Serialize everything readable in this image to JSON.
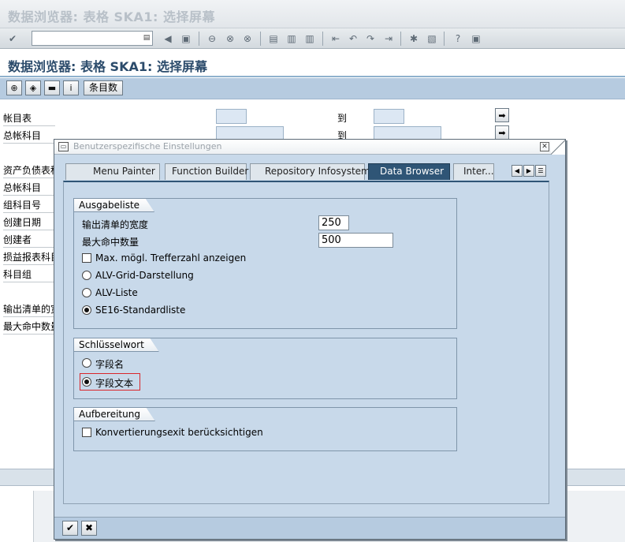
{
  "window": {
    "title": "数据浏览器: 表格 SKA1: 选择屏幕"
  },
  "toolbar": {
    "icons": [
      "enter-icon",
      "back-icon",
      "exit-icon",
      "cancel-icon",
      "print-icon",
      "find-icon",
      "find-next-icon",
      "first-page-icon",
      "prev-page-icon",
      "next-page-icon",
      "last-page-icon",
      "new-session-icon",
      "shortcut-icon",
      "help-icon",
      "layout-icon"
    ]
  },
  "app": {
    "title": "数据浏览器: 表格 SKA1: 选择屏幕",
    "number_of_entries_label": "条目数"
  },
  "selection": {
    "to_label": "到",
    "rows": [
      {
        "label": "帐目表"
      },
      {
        "label": "总帐科目"
      },
      {
        "label": "资产负债表科目"
      },
      {
        "label": "总帐科目"
      },
      {
        "label": "组科目号"
      },
      {
        "label": "创建日期"
      },
      {
        "label": "创建者"
      },
      {
        "label": "损益报表科目"
      },
      {
        "label": "科目组"
      },
      {
        "label": "输出清单的宽度"
      },
      {
        "label": "最大命中数量"
      }
    ]
  },
  "dialog": {
    "title": "Benutzerspezifische Einstellungen",
    "tabs": [
      {
        "label": "Menu Painter",
        "active": false
      },
      {
        "label": "Function Builder",
        "active": false
      },
      {
        "label": "Repository Infosystem",
        "active": false
      },
      {
        "label": "Data Browser",
        "active": true
      },
      {
        "label": "Inter...",
        "active": false
      }
    ],
    "ausgabeliste": {
      "title": "Ausgabeliste",
      "width_label": "输出清单的宽度",
      "width_value": "250",
      "max_hits_label": "最大命中数量",
      "max_hits_value": "500",
      "show_max_hits_label": "Max. mögl. Trefferzahl anzeigen",
      "show_max_hits_checked": false,
      "options": [
        {
          "label": "ALV-Grid-Darstellung",
          "selected": false
        },
        {
          "label": "ALV-Liste",
          "selected": false
        },
        {
          "label": "SE16-Standardliste",
          "selected": true
        }
      ]
    },
    "schluesselwort": {
      "title": "Schlüsselwort",
      "options": [
        {
          "label": "字段名",
          "selected": false
        },
        {
          "label": "字段文本",
          "selected": true
        }
      ]
    },
    "aufbereitung": {
      "title": "Aufbereitung",
      "conversion_exit_label": "Konvertierungsexit berücksichtigen",
      "conversion_exit_checked": false
    }
  }
}
